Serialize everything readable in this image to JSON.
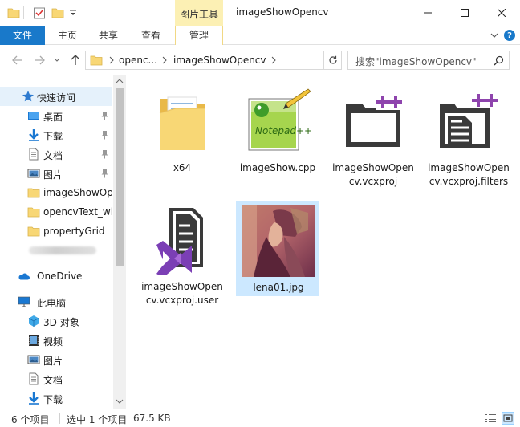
{
  "window": {
    "title": "imageShowOpencv",
    "context_tab": "图片工具"
  },
  "ribbon": {
    "file": "文件",
    "home": "主页",
    "share": "共享",
    "view": "查看",
    "manage": "管理",
    "help": "?"
  },
  "address": {
    "crumbs": [
      "openc...",
      "imageShowOpencv"
    ],
    "search_placeholder": "搜索\"imageShowOpencv\""
  },
  "sidebar": {
    "quick_access": "快速访问",
    "items": [
      {
        "label": "桌面",
        "icon": "desktop-icon",
        "pinned": true
      },
      {
        "label": "下载",
        "icon": "download-icon",
        "pinned": true
      },
      {
        "label": "文档",
        "icon": "document-icon",
        "pinned": true
      },
      {
        "label": "图片",
        "icon": "pictures-icon",
        "pinned": true
      },
      {
        "label": "imageShowOp",
        "icon": "folder-icon",
        "pinned": false
      },
      {
        "label": "opencvText_wir",
        "icon": "folder-icon",
        "pinned": false
      },
      {
        "label": "propertyGrid",
        "icon": "folder-icon",
        "pinned": false
      }
    ],
    "onedrive": "OneDrive",
    "this_pc": "此电脑",
    "pc_items": [
      {
        "label": "3D 对象",
        "icon": "3d-objects-icon"
      },
      {
        "label": "视频",
        "icon": "video-icon"
      },
      {
        "label": "图片",
        "icon": "pictures-icon"
      },
      {
        "label": "文档",
        "icon": "document-icon"
      },
      {
        "label": "下载",
        "icon": "download-icon"
      }
    ]
  },
  "files": [
    {
      "name": "x64",
      "icon": "folder-icon"
    },
    {
      "name": "imageShow.cpp",
      "icon": "notepadpp-icon"
    },
    {
      "name": "imageShowOpencv.vcxproj",
      "icon": "vcxproj-icon"
    },
    {
      "name": "imageShowOpencv.vcxproj.filters",
      "icon": "vcxproj-filters-icon"
    },
    {
      "name": "imageShowOpencv.vcxproj.user",
      "icon": "visual-studio-icon"
    },
    {
      "name": "lena01.jpg",
      "icon": "image-thumbnail",
      "selected": true
    }
  ],
  "status": {
    "count": "6 个项目",
    "selected": "选中 1 个项目",
    "size": "67.5 KB"
  },
  "colors": {
    "accent": "#1979ca",
    "context_tab": "#fcf0b4",
    "selection": "#cce8ff",
    "folder": "#f8d775"
  }
}
